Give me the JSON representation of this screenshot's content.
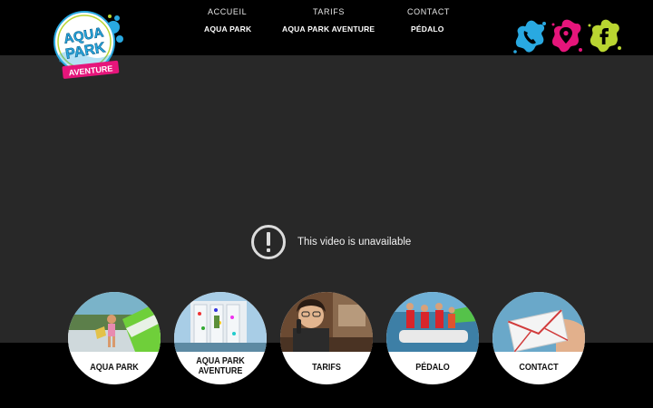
{
  "nav": {
    "top": [
      "ACCUEIL",
      "TARIFS",
      "CONTACT"
    ],
    "bottom": [
      "AQUA PARK",
      "AQUA PARK AVENTURE",
      "PÉDALO"
    ]
  },
  "logo": {
    "line1": "AQUA",
    "line2": "PARK",
    "line3": "AVENTURE"
  },
  "social": [
    {
      "icon": "phone-icon",
      "color": "#29a9e1"
    },
    {
      "icon": "location-pin-icon",
      "color": "#e6157b"
    },
    {
      "icon": "facebook-icon",
      "color": "#b9d531"
    }
  ],
  "video": {
    "message": "This video is unavailable"
  },
  "circles": [
    {
      "line1": "AQUA PARK",
      "line2": ""
    },
    {
      "line1": "AQUA PARK",
      "line2": "AVENTURE"
    },
    {
      "line1": "TARIFS",
      "line2": ""
    },
    {
      "line1": "PÉDALO",
      "line2": ""
    },
    {
      "line1": "CONTACT",
      "line2": ""
    }
  ],
  "colors": {
    "brand_blue": "#29a9e1",
    "brand_pink": "#e6157b",
    "brand_green": "#b9d531",
    "video_bg": "#282828"
  }
}
